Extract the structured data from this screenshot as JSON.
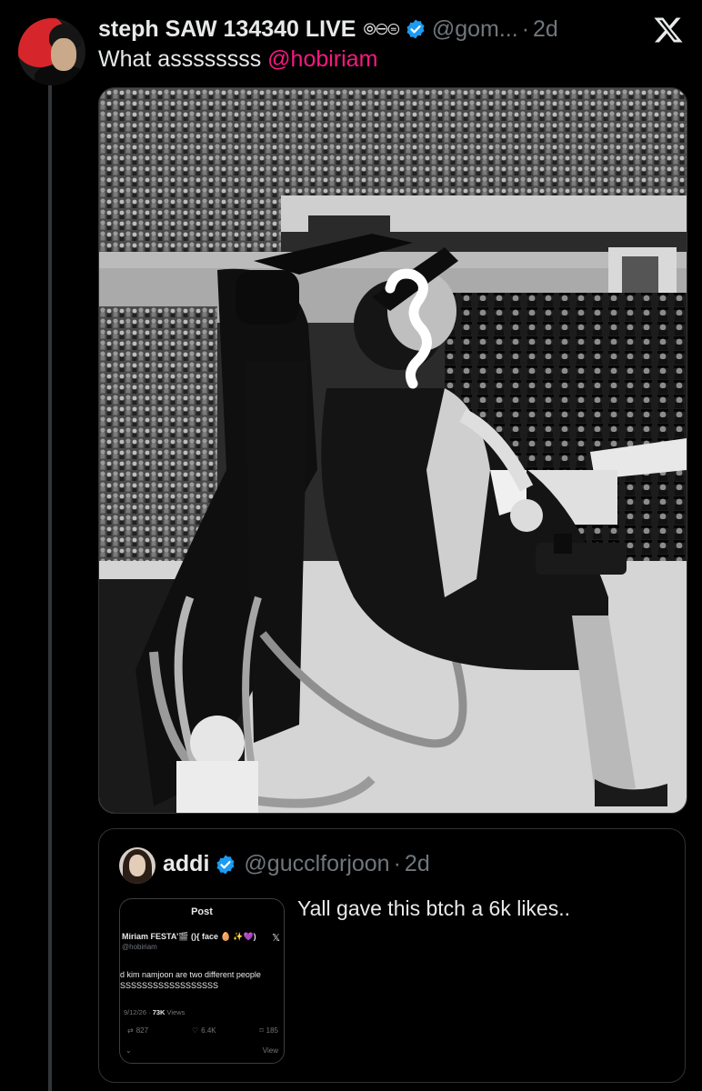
{
  "tweet": {
    "display_name": "steph SAW 134340 LIVE",
    "name_emoji": "⦾⊖⊜",
    "handle": "@gom...",
    "time_sep": "·",
    "time": "2d",
    "text_prefix": "What assssssss ",
    "mention": "@hobiriam",
    "icons": {
      "verified": "verified-badge-icon",
      "close": "x-logo-icon"
    }
  },
  "quoted": {
    "display_name": "addi",
    "handle": "@gucclforjoon",
    "time_sep": "·",
    "time": "2d",
    "text": "Yall gave this btch a 6k likes..",
    "embedded_post": {
      "title": "Post",
      "author": "Miriam FESTA’🎬 (){ face 🥚 ✨💜)",
      "handle": "@hobiriam",
      "line1": "d kim namjoon are two different people",
      "line2": "SSSSSSSSSSSSSSSSSS",
      "date": "9/12/26 · ",
      "views_count": "73K",
      "views_label": " Views",
      "retweets": "827",
      "likes": "6.4K",
      "bookmarks": "185",
      "footer_right": "View"
    }
  },
  "colors": {
    "accent_blue": "#1d9bf0",
    "mention_pink": "#f91880",
    "muted": "#71767b"
  }
}
